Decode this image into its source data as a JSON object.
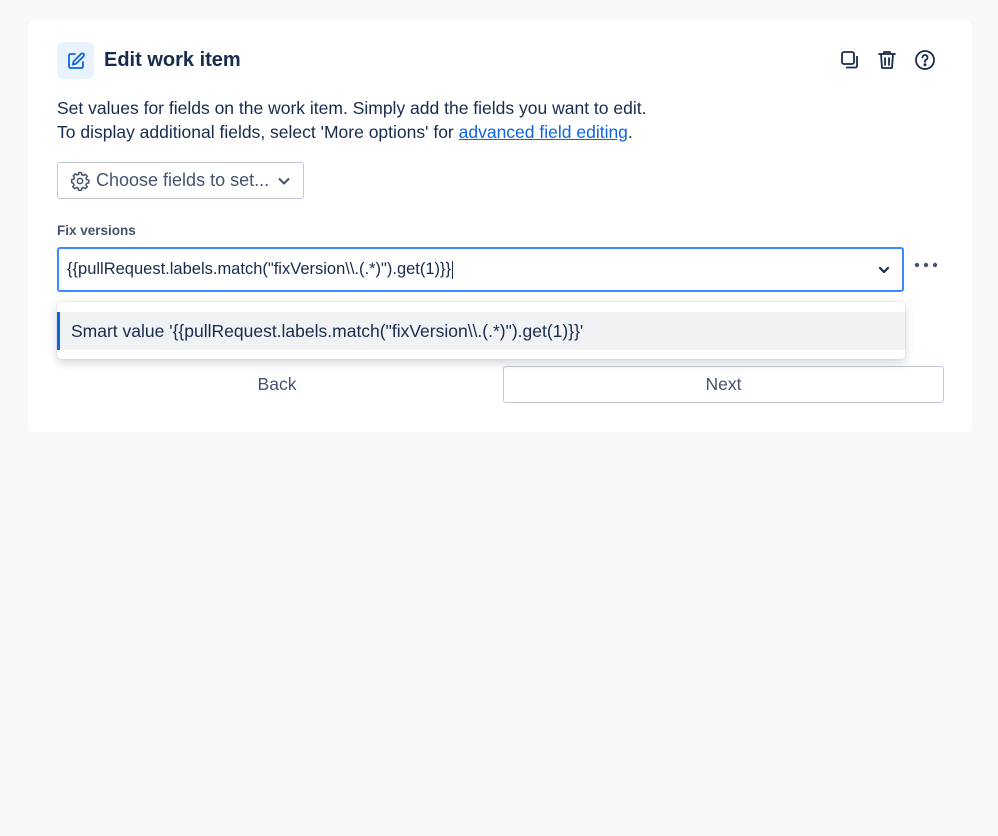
{
  "header": {
    "title": "Edit work item",
    "icons": {
      "main": "edit-icon",
      "copy": "copy-icon",
      "delete": "trash-icon",
      "help": "help-icon"
    }
  },
  "description": {
    "line1": "Set values for fields on the work item. Simply add the fields you want to edit.",
    "line2_prefix": "To display additional fields, select 'More options' for ",
    "link_text": "advanced field editing",
    "line2_suffix": "."
  },
  "choose_fields": {
    "label": "Choose fields to set..."
  },
  "field": {
    "label": "Fix versions",
    "value": "{{pullRequest.labels.match(\"fixVersion\\\\.(.*)\").get(1)}}"
  },
  "dropdown": {
    "options": [
      {
        "label": "Smart value '{{pullRequest.labels.match(\"fixVersion\\\\.(.*)\").get(1)}}'"
      }
    ]
  },
  "actions": {
    "back_label": "Back",
    "next_label": "Next"
  },
  "colors": {
    "accent": "#0c66e4",
    "focus_border": "#388bff",
    "icon_bg": "#e9f2ff"
  }
}
